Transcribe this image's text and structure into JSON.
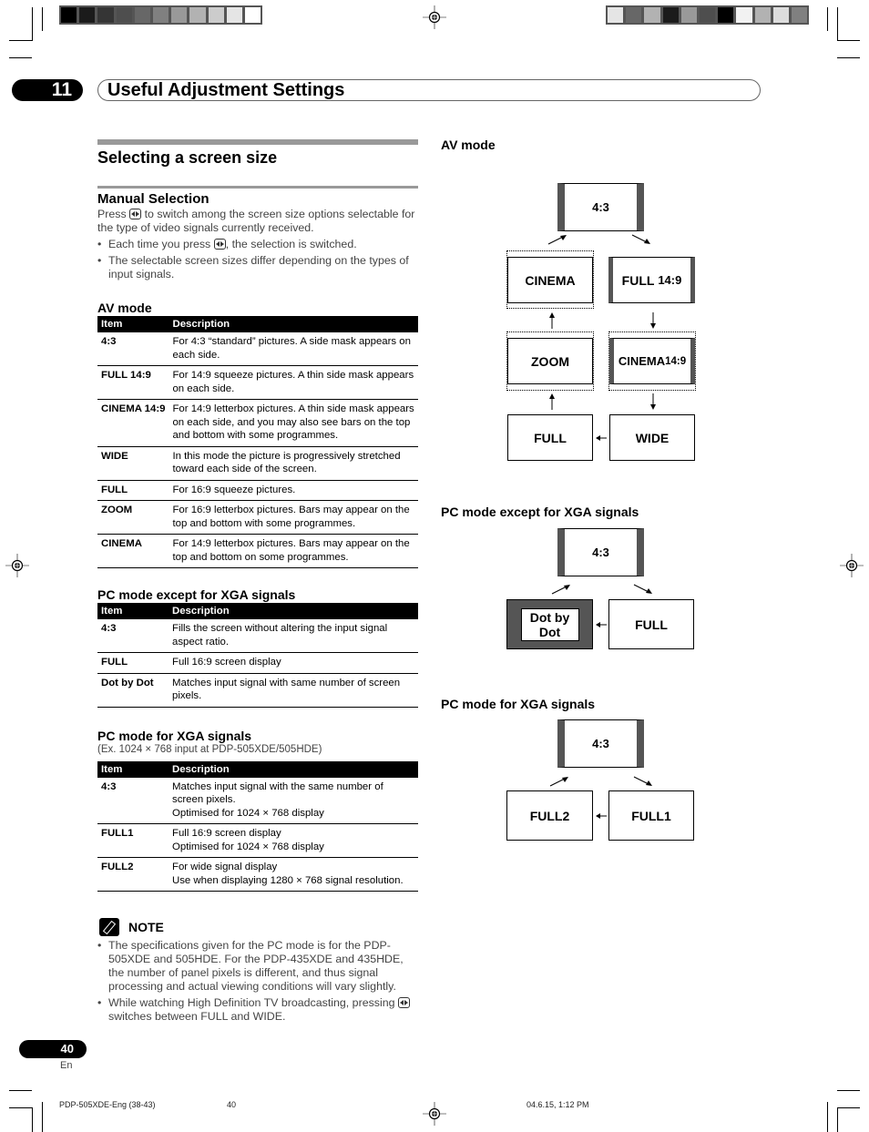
{
  "header": {
    "chapter_number": "11",
    "chapter_title": "Useful Adjustment Settings",
    "swatches_left": [
      "#000000",
      "#1b1b1b",
      "#353535",
      "#4e4e4e",
      "#676767",
      "#808080",
      "#999999",
      "#b2b2b2",
      "#cccccc",
      "#e5e5e5",
      "#ffffff"
    ],
    "swatches_right": [
      "#e5e5e5",
      "#676767",
      "#b2b2b2",
      "#1b1b1b",
      "#999999",
      "#4e4e4e",
      "#000000",
      "#f2f2f2",
      "#b2b2b2",
      "#dddddd",
      "#808080"
    ]
  },
  "section": {
    "title": "Selecting a screen size",
    "subtitle": "Manual Selection",
    "intro_before": "Press",
    "intro_after": "to switch among the screen size options selectable for the type of video signals currently received.",
    "bullet1_before": "Each time you press",
    "bullet1_after": ", the selection is switched.",
    "bullet2": "The selectable screen sizes differ depending on the types of input signals.",
    "button_icon": "screen-size-button-icon"
  },
  "tables": {
    "av": {
      "heading": "AV mode",
      "col_item": "Item",
      "col_desc": "Description",
      "rows": [
        {
          "item": "4:3",
          "desc": "For 4:3 “standard” pictures. A side mask appears on each side."
        },
        {
          "item": "FULL 14:9",
          "desc": "For 14:9 squeeze pictures. A thin side mask appears on each side."
        },
        {
          "item": "CINEMA 14:9",
          "desc": "For 14:9 letterbox pictures. A thin side mask appears on each side, and you may also see bars on the top and bottom with some programmes."
        },
        {
          "item": "WIDE",
          "desc": "In this mode the picture is progressively stretched toward each side of the screen."
        },
        {
          "item": "FULL",
          "desc": "For 16:9 squeeze pictures."
        },
        {
          "item": "ZOOM",
          "desc": "For 16:9 letterbox pictures. Bars may appear on the top and bottom with some programmes."
        },
        {
          "item": "CINEMA",
          "desc": "For 14:9 letterbox pictures. Bars may appear on the top and bottom on some programmes."
        }
      ]
    },
    "pc": {
      "heading": "PC mode except for XGA signals",
      "col_item": "Item",
      "col_desc": "Description",
      "rows": [
        {
          "item": "4:3",
          "desc": "Fills the screen without altering the input signal aspect ratio."
        },
        {
          "item": "FULL",
          "desc": "Full 16:9 screen display"
        },
        {
          "item": "Dot by Dot",
          "desc": "Matches input signal with same number of screen pixels."
        }
      ]
    },
    "xga": {
      "heading": "PC mode for XGA signals",
      "subheading": "(Ex. 1024 × 768 input at PDP-505XDE/505HDE)",
      "col_item": "Item",
      "col_desc": "Description",
      "rows": [
        {
          "item": "4:3",
          "desc_lines": [
            "Matches input signal with the same number of screen pixels.",
            "Optimised for 1024 × 768 display"
          ]
        },
        {
          "item": "FULL1",
          "desc_lines": [
            "Full 16:9 screen display",
            "Optimised for 1024 × 768 display"
          ]
        },
        {
          "item": "FULL2",
          "desc_lines": [
            "For wide signal display",
            "Use when displaying 1280 × 768 signal resolution."
          ]
        }
      ]
    }
  },
  "note": {
    "title": "NOTE",
    "bullet1": "The specifications given for the PC mode is for the PDP-505XDE and 505HDE. For the PDP-435XDE and 435HDE, the number of panel pixels is different, and thus signal processing and actual viewing conditions will vary slightly.",
    "bullet2_before": "While watching High Definition TV broadcasting, pressing",
    "bullet2_after": "switches between FULL and WIDE."
  },
  "diagrams": {
    "av": {
      "heading": "AV mode",
      "boxes": {
        "top": "4:3",
        "cinema": "CINEMA",
        "full149_a": "FULL",
        "full149_b": "14:9",
        "zoom": "ZOOM",
        "cinema149_a": "CINEMA",
        "cinema149_b": "14:9",
        "full": "FULL",
        "wide": "WIDE"
      }
    },
    "pc": {
      "heading": "PC mode except for XGA signals",
      "boxes": {
        "top": "4:3",
        "dbd_1": "Dot by",
        "dbd_2": "Dot",
        "full": "FULL"
      }
    },
    "xga": {
      "heading": "PC mode for XGA signals",
      "boxes": {
        "top": "4:3",
        "full2": "FULL2",
        "full1": "FULL1"
      }
    }
  },
  "footer": {
    "page_number": "40",
    "language": "En",
    "file": "PDP-505XDE-Eng (38-43)",
    "page": "40",
    "timestamp": "04.6.15, 1:12 PM"
  }
}
